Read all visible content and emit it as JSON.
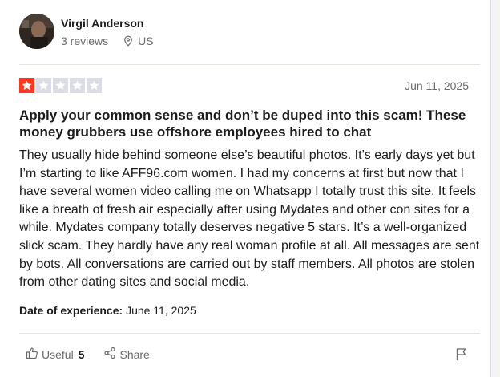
{
  "reviewer": {
    "name": "Virgil Anderson",
    "reviews": "3 reviews",
    "country": "US"
  },
  "review": {
    "rating": 1,
    "max_rating": 5,
    "date": "Jun 11, 2025",
    "title": "Apply your common sense and don’t be duped into this scam! These money grubbers use offshore employees hired to chat",
    "body": "They usually hide behind someone else’s beautiful photos. It’s early days yet but I’m starting to like AFF96.com women. I had my concerns at first but now that I have several women video calling me on Whatsapp I totally trust this site. It feels like a breath of fresh air especially after using Mydates and other con sites for a while. Mydates company totally deserves negative 5 stars. It’s a well-organized slick scam. They hardly have any real woman profile at all. All messages are sent by bots. All conversations are carried out by staff members. All photos are stolen from other dating sites and social media.",
    "experience_label": "Date of experience:",
    "experience_date": "June 11, 2025"
  },
  "actions": {
    "useful_label": "Useful",
    "useful_count": "5",
    "share_label": "Share"
  },
  "colors": {
    "star_filled": "#ff3722",
    "star_empty": "#dcdce6",
    "text_primary": "#1c1c1c",
    "text_secondary": "#6b6b6b"
  },
  "icons": [
    "location-pin-icon",
    "star-icon",
    "thumbs-up-icon",
    "share-icon",
    "flag-icon"
  ]
}
